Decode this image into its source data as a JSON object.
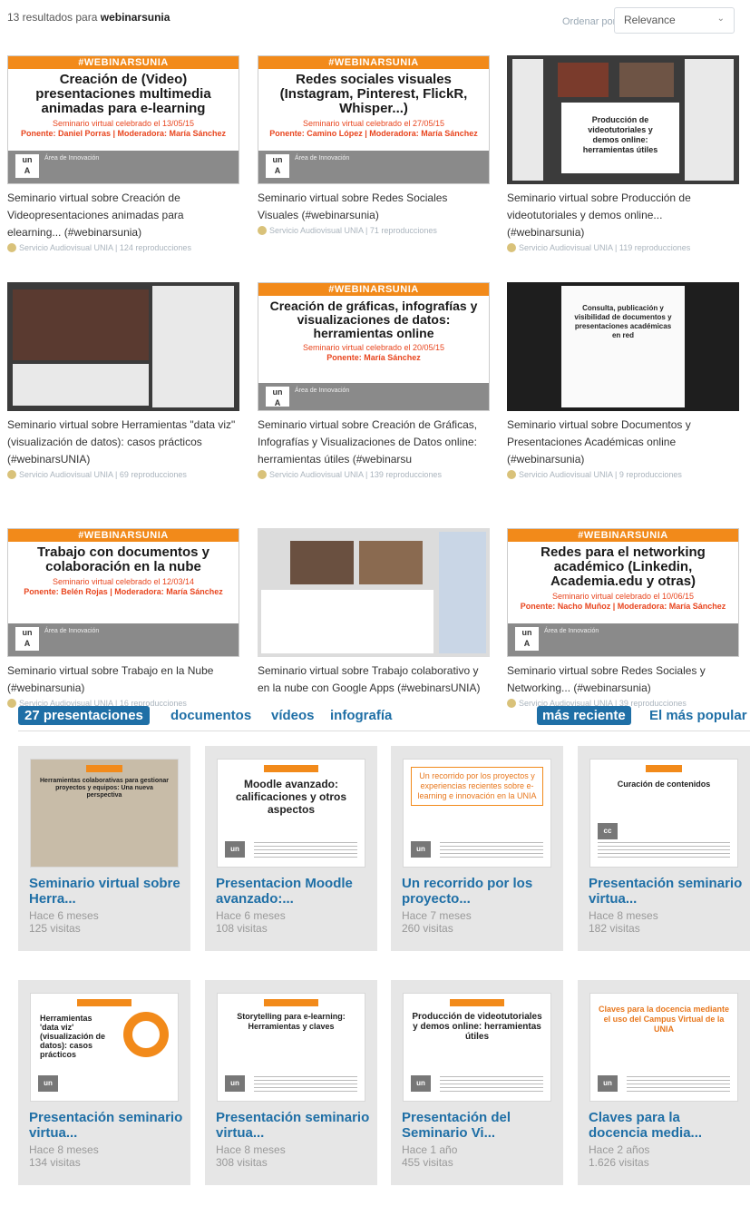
{
  "header": {
    "results_count": "13 resultados para ",
    "query": "webinarsunia",
    "sort_label": "Ordenar por:",
    "sort_value": "Relevance"
  },
  "videos": [
    {
      "band": "#WEBINARSUNIA",
      "poster_title": "Creación de (Video) presentaciones multimedia animadas para e-learning",
      "poster_date": "Seminario virtual celebrado el 13/05/15",
      "poster_speaker": "Ponente: Daniel Porras | Moderadora: María Sánchez",
      "footer": "Área de Innovación",
      "title": "Seminario virtual sobre Creación de Videopresentaciones animadas para elearning... (#webinarsunia)",
      "meta": "Servicio Audiovisual UNIA | 124 reproducciones"
    },
    {
      "band": "#WEBINARSUNIA",
      "poster_title": "Redes sociales visuales (Instagram, Pinterest, FlickR, Whisper...)",
      "poster_date": "Seminario virtual celebrado el 27/05/15",
      "poster_speaker": "Ponente: Camino López | Moderadora: María Sánchez",
      "footer": "Área de Innovación",
      "title": "Seminario virtual sobre Redes Sociales Visuales (#webinarsunia)",
      "meta": "Servicio Audiovisual UNIA | 71 reproducciones"
    },
    {
      "screen_text": "Producción de videotutoriales y demos online: herramientas útiles",
      "title": "Seminario virtual sobre Producción de videotutoriales y demos online... (#webinarsunia)",
      "meta": "Servicio Audiovisual UNIA | 119 reproducciones"
    },
    {
      "title": "Seminario virtual sobre Herramientas \"data viz\" (visualización de datos): casos prácticos (#webinarsUNIA)",
      "meta": "Servicio Audiovisual UNIA | 69 reproducciones"
    },
    {
      "band": "#WEBINARSUNIA",
      "poster_title": "Creación de gráficas, infografías y visualizaciones de datos: herramientas online",
      "poster_date": "Seminario virtual celebrado el 20/05/15",
      "poster_speaker": "Ponente: María Sánchez",
      "footer": "Área de Innovación",
      "title": "Seminario virtual sobre Creación de Gráficas, Infografías y Visualizaciones de Datos online: herramientas útiles (#webinarsu",
      "meta": "Servicio Audiovisual UNIA | 139 reproducciones"
    },
    {
      "screen_text": "Consulta, publicación y visibilidad de documentos y presentaciones académicas en red",
      "title": "Seminario virtual sobre Documentos y Presentaciones Académicas online (#webinarsunia)",
      "meta": "Servicio Audiovisual UNIA | 9 reproducciones"
    },
    {
      "band": "#WEBINARSUNIA",
      "poster_title": "Trabajo con documentos y colaboración en la nube",
      "poster_date": "Seminario virtual celebrado el 12/03/14",
      "poster_speaker": "Ponente: Belén Rojas | Moderadora: María Sánchez",
      "footer": "Área de Innovación",
      "title": "Seminario virtual sobre Trabajo en la Nube (#webinarsunia)",
      "meta": "Servicio Audiovisual UNIA | 16 reproducciones"
    },
    {
      "title": "Seminario virtual sobre Trabajo colaborativo y en la nube con Google Apps (#webinarsUNIA)",
      "meta": ""
    },
    {
      "band": "#WEBINARSUNIA",
      "poster_title": "Redes para el networking académico (Linkedin, Academia.edu y otras)",
      "poster_date": "Seminario virtual celebrado el 10/06/15",
      "poster_speaker": "Ponente: Nacho Muñoz | Moderadora: María Sánchez",
      "footer": "Área de Innovación",
      "title": "Seminario virtual sobre Redes Sociales y Networking... (#webinarsunia)",
      "meta": "Servicio Audiovisual UNIA | 39 reproducciones"
    }
  ],
  "tabs": {
    "presentations": "27 presentaciones",
    "documents": "documentos",
    "videos": "vídeos",
    "infographic": "infografía",
    "recent": "más reciente",
    "popular": "El más popular"
  },
  "presentations": [
    {
      "title": "Seminario virtual sobre Herra...",
      "age": "Hace 6 meses",
      "views": "125 visitas",
      "thumb": "Herramientas colaborativas para gestionar proyectos y equipos: Una nueva perspectiva"
    },
    {
      "title": "Presentacion Moodle avanzado:...",
      "age": "Hace 6 meses",
      "views": "108 visitas",
      "thumb": "Moodle avanzado: calificaciones y otros aspectos"
    },
    {
      "title": "Un recorrido por los proyecto...",
      "age": "Hace 7 meses",
      "views": "260 visitas",
      "thumb": "Un recorrido por los proyectos y experiencias recientes sobre e-learning e innovación en la UNIA"
    },
    {
      "title": "Presentación seminario virtua...",
      "age": "Hace 8 meses",
      "views": "182 visitas",
      "thumb": "Curación de contenidos"
    },
    {
      "title": "Presentación seminario virtua...",
      "age": "Hace 8 meses",
      "views": "134 visitas",
      "thumb": "Herramientas 'data viz' (visualización de datos): casos prácticos"
    },
    {
      "title": "Presentación seminario virtua...",
      "age": "Hace 8 meses",
      "views": "308 visitas",
      "thumb": "Storytelling para e-learning: Herramientas y claves"
    },
    {
      "title": "Presentación del Seminario Vi...",
      "age": "Hace 1 año",
      "views": "455 visitas",
      "thumb": "Producción de videotutoriales y demos online: herramientas útiles"
    },
    {
      "title": "Claves para la docencia media...",
      "age": "Hace 2 años",
      "views": "1.626 visitas",
      "thumb": "Claves para la docencia mediante el uso del Campus Virtual de la UNIA"
    }
  ]
}
